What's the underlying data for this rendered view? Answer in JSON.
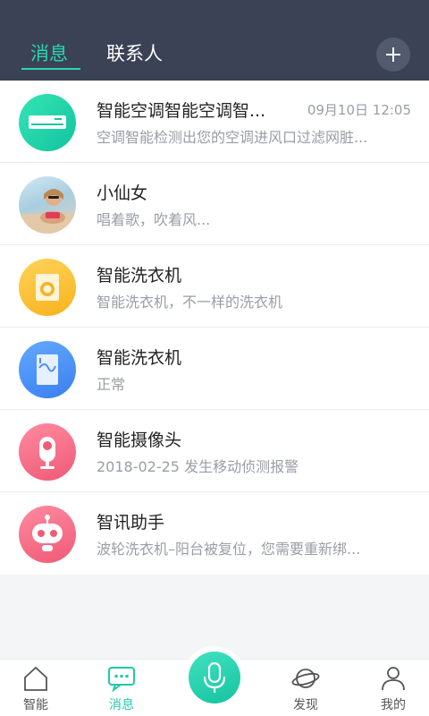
{
  "header": {
    "tabs": [
      {
        "label": "消息",
        "active": true
      },
      {
        "label": "联系人",
        "active": false
      }
    ],
    "add_icon": "plus-icon"
  },
  "messages": [
    {
      "title": "智能空调智能空调智...",
      "time": "09月10日 12:05",
      "subtitle": "空调智能检测出您的空调进风口过滤网脏...",
      "avatar_icon": "air-conditioner-icon"
    },
    {
      "title": "小仙女",
      "time": "",
      "subtitle": "唱着歌，吹着风...",
      "avatar_icon": "user-photo"
    },
    {
      "title": "智能洗衣机",
      "time": "",
      "subtitle": "智能洗衣机，不一样的洗衣机",
      "avatar_icon": "washing-machine-icon"
    },
    {
      "title": "智能洗衣机",
      "time": "",
      "subtitle": "正常",
      "avatar_icon": "fridge-icon"
    },
    {
      "title": "智能摄像头",
      "time": "",
      "subtitle": "2018-02-25 发生移动侦测报警",
      "avatar_icon": "camera-icon"
    },
    {
      "title": "智讯助手",
      "time": "",
      "subtitle": "波轮洗衣机–阳台被复位，您需要重新绑...",
      "avatar_icon": "robot-icon"
    }
  ],
  "tabbar": {
    "items": [
      {
        "label": "智能",
        "icon": "home-icon",
        "active": false
      },
      {
        "label": "消息",
        "icon": "chat-icon",
        "active": true
      },
      {
        "label": "",
        "icon": "microphone-icon",
        "active": false
      },
      {
        "label": "发现",
        "icon": "planet-icon",
        "active": false
      },
      {
        "label": "我的",
        "icon": "person-icon",
        "active": false
      }
    ]
  },
  "colors": {
    "header_bg": "#3b4256",
    "accent": "#27d6b4",
    "list_bg": "#ffffff",
    "page_bg": "#f4f5f7"
  }
}
